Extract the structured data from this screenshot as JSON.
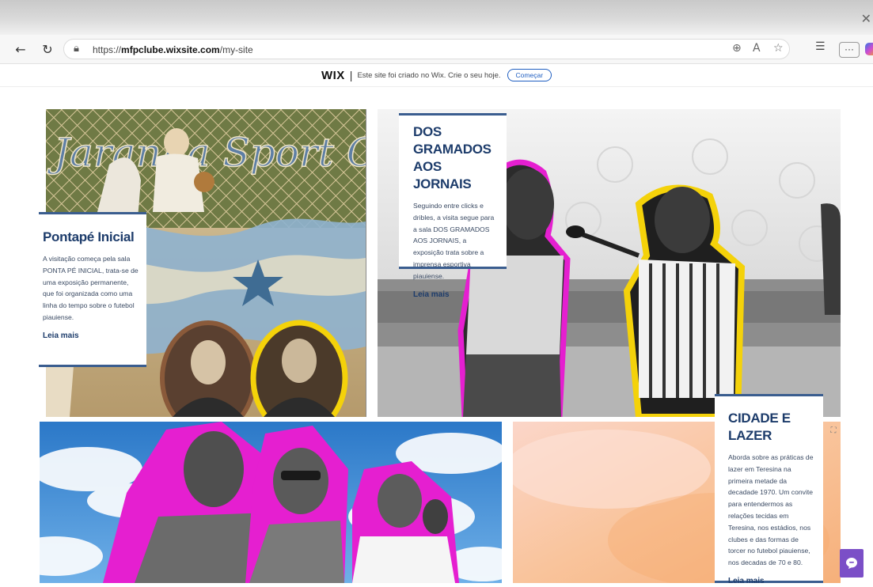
{
  "browser": {
    "url_prefix": "https://",
    "url_domain": "mfpclube.wixsite.com",
    "url_path": "/my-site",
    "icons": [
      "back-icon",
      "refresh-icon",
      "lock-icon",
      "zoom-icon",
      "read-aloud-icon",
      "favorite-icon",
      "favorites-bar-icon",
      "more-icon",
      "copilot-icon",
      "close-icon"
    ],
    "more_label": "···"
  },
  "wix_banner": {
    "logo": "WIX",
    "separator": "|",
    "message": "Este site foi criado no Wix. Crie o seu hoje.",
    "cta": "Começar",
    "accent": "#1f5ec1"
  },
  "sections": [
    {
      "title": "Pontapé Inicial",
      "text": "A visitação começa pela sala PONTA PÉ INICIAL, trata-se de uma exposição permanente, que foi organizada como uma linha do tempo sobre o futebol piauiense.",
      "link": "Leia mais",
      "image": "vintage-football-poster"
    },
    {
      "title": "DOS GRAMADOS AOS JORNAIS",
      "text": "Seguindo entre clicks e dribles, a visita segue para a sala DOS GRAMADOS AOS JORNAIS, a exposição trata sobre a imprensa esportiva piauiense.",
      "link": "Leia mais",
      "image": "reporter-interview-photo"
    },
    {
      "title": "CIDADE E LAZER",
      "text": "Aborda sobre as práticas de lazer em Teresina na primeira metade da decadade 1970. Um convite para entendermos as relações tecidas em Teresina, nos estádios, nos clubes e das formas de torcer no futebol piauiense, nos decadas de 70 e 80.",
      "link": "Leia mais",
      "image": "orange-watercolor-background"
    },
    {
      "image": "men-collage-sky"
    }
  ],
  "colors": {
    "heading": "#1d3c6b",
    "card_border": "#3a5d8f",
    "highlight_magenta": "#e51fd0",
    "highlight_yellow": "#f4d20a",
    "chat_button": "#7b4fc7"
  },
  "chat": {
    "icon": "chat-icon"
  },
  "expand": {
    "icon": "expand-icon"
  }
}
